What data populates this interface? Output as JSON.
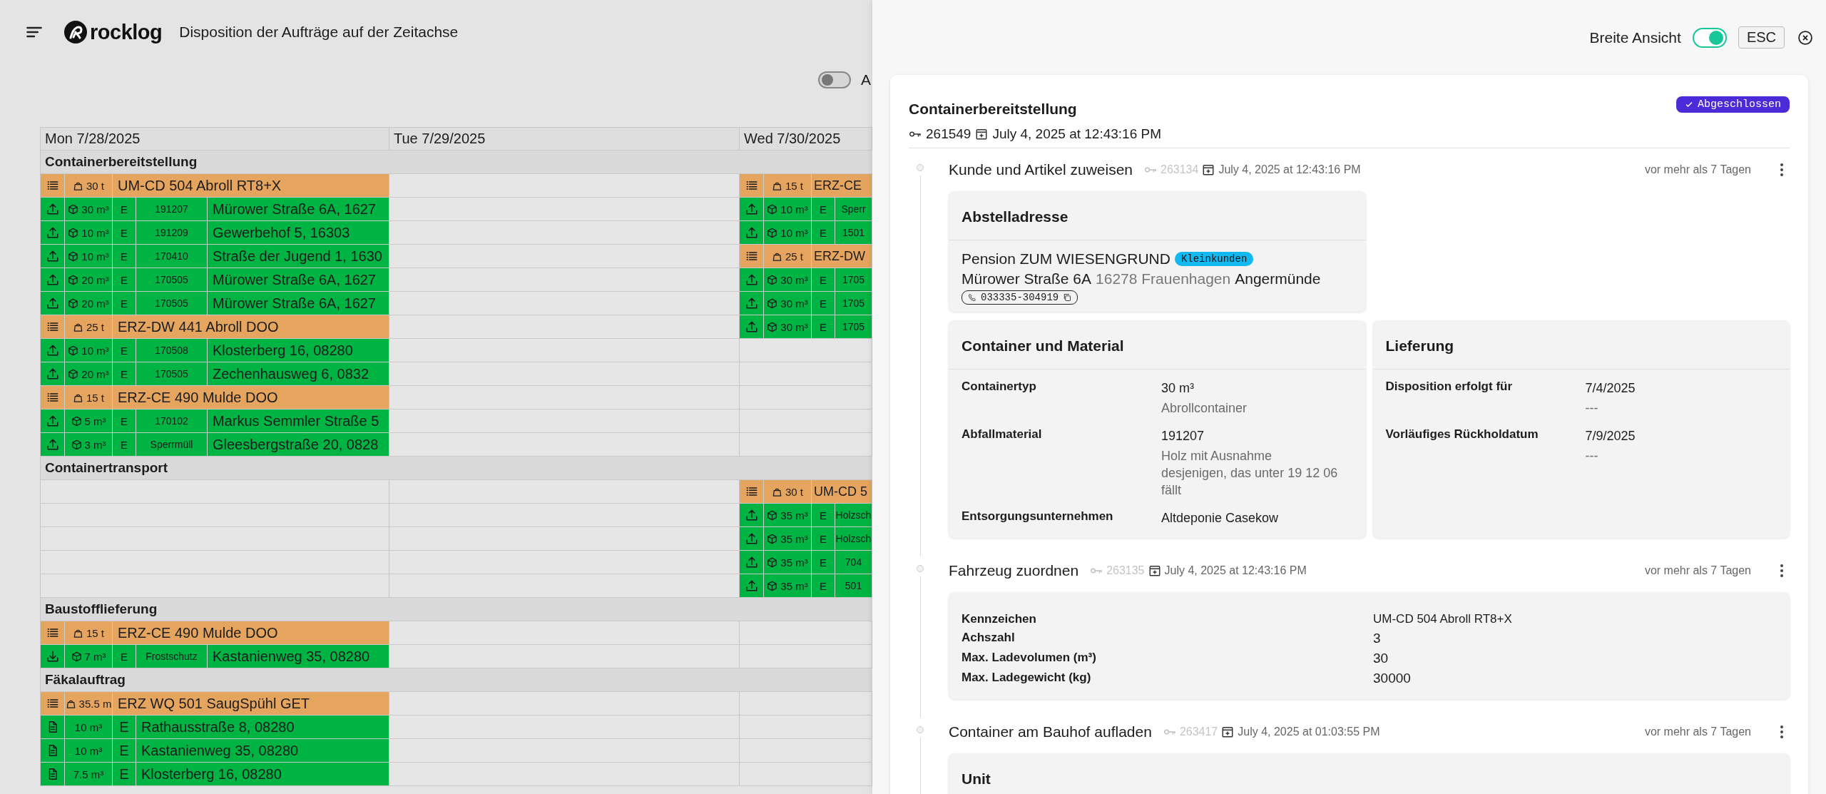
{
  "header": {
    "logo_text": "rocklog",
    "title": "Disposition der Aufträge auf der Zeitachse"
  },
  "view_toggle": {
    "label": "A",
    "on": false
  },
  "timeline": {
    "days": [
      "Mon 7/28/2025",
      "Tue 7/29/2025",
      "Wed 7/30/2025"
    ],
    "sections": [
      {
        "title": "Containerbereitstellung",
        "rows": [
          {
            "cells": [
              {
                "kind": "vehicle",
                "capacity": "30 t",
                "name": "UM-CD 504 Abroll RT8+X"
              },
              {
                "kind": "empty"
              },
              {
                "kind": "vehicle",
                "capacity": "15 t",
                "name": "ERZ-CE"
              }
            ]
          },
          {
            "cells": [
              {
                "kind": "order",
                "delivery": false,
                "volume": "30 m³",
                "type": "E",
                "code": "191207",
                "address": "Mürower Straße 6A, 1627"
              },
              {
                "kind": "empty"
              },
              {
                "kind": "order",
                "delivery": false,
                "volume": "10 m³",
                "type": "E",
                "code": "Sperr"
              }
            ]
          },
          {
            "cells": [
              {
                "kind": "order",
                "delivery": false,
                "volume": "10 m³",
                "type": "E",
                "code": "191209",
                "address": "Gewerbehof 5, 16303"
              },
              {
                "kind": "empty"
              },
              {
                "kind": "order",
                "delivery": false,
                "volume": "10 m³",
                "type": "E",
                "code": "1501"
              }
            ]
          },
          {
            "cells": [
              {
                "kind": "order",
                "delivery": false,
                "volume": "10 m³",
                "type": "E",
                "code": "170410",
                "address": "Straße der Jugend 1, 1630"
              },
              {
                "kind": "empty"
              },
              {
                "kind": "vehicle",
                "capacity": "25 t",
                "name": "ERZ-DW"
              }
            ]
          },
          {
            "cells": [
              {
                "kind": "order",
                "delivery": false,
                "volume": "20 m³",
                "type": "E",
                "code": "170505",
                "address": "Mürower Straße 6A, 1627"
              },
              {
                "kind": "empty"
              },
              {
                "kind": "order",
                "delivery": false,
                "volume": "30 m³",
                "type": "E",
                "code": "1705"
              }
            ]
          },
          {
            "cells": [
              {
                "kind": "order",
                "delivery": false,
                "volume": "20 m³",
                "type": "E",
                "code": "170505",
                "address": "Mürower Straße 6A, 1627"
              },
              {
                "kind": "empty"
              },
              {
                "kind": "order",
                "delivery": false,
                "volume": "30 m³",
                "type": "E",
                "code": "1705"
              }
            ]
          },
          {
            "cells": [
              {
                "kind": "vehicle",
                "capacity": "25 t",
                "name": "ERZ-DW 441 Abroll DOO"
              },
              {
                "kind": "empty"
              },
              {
                "kind": "order",
                "delivery": false,
                "volume": "30 m³",
                "type": "E",
                "code": "1705"
              }
            ]
          },
          {
            "cells": [
              {
                "kind": "order",
                "delivery": false,
                "volume": "10 m³",
                "type": "E",
                "code": "170508",
                "address": "Klosterberg 16, 08280"
              },
              {
                "kind": "empty"
              },
              {
                "kind": "empty"
              }
            ]
          },
          {
            "cells": [
              {
                "kind": "order",
                "delivery": false,
                "volume": "20 m³",
                "type": "E",
                "code": "170505",
                "address": "Zechenhausweg 6, 0832"
              },
              {
                "kind": "empty"
              },
              {
                "kind": "empty"
              }
            ]
          },
          {
            "cells": [
              {
                "kind": "vehicle",
                "capacity": "15 t",
                "name": "ERZ-CE 490 Mulde DOO"
              },
              {
                "kind": "empty"
              },
              {
                "kind": "empty"
              }
            ]
          },
          {
            "cells": [
              {
                "kind": "order",
                "delivery": false,
                "volume": "5 m³",
                "type": "E",
                "code": "170102",
                "address": "Markus Semmler Straße 5"
              },
              {
                "kind": "empty"
              },
              {
                "kind": "empty"
              }
            ]
          },
          {
            "cells": [
              {
                "kind": "order",
                "delivery": false,
                "volume": "3 m³",
                "type": "E",
                "code": "Sperrmüll",
                "address": "Gleesbergstraße 20, 0828"
              },
              {
                "kind": "empty"
              },
              {
                "kind": "empty"
              }
            ]
          }
        ]
      },
      {
        "title": "Containertransport",
        "rows": [
          {
            "cells": [
              {
                "kind": "empty"
              },
              {
                "kind": "empty"
              },
              {
                "kind": "vehicle",
                "capacity": "30 t",
                "name": "UM-CD 5"
              }
            ]
          },
          {
            "cells": [
              {
                "kind": "empty"
              },
              {
                "kind": "empty"
              },
              {
                "kind": "order",
                "delivery": false,
                "volume": "35 m³",
                "type": "E",
                "code": "Holzsch"
              }
            ]
          },
          {
            "cells": [
              {
                "kind": "empty"
              },
              {
                "kind": "empty"
              },
              {
                "kind": "order",
                "delivery": false,
                "volume": "35 m³",
                "type": "E",
                "code": "Holzsch"
              }
            ]
          },
          {
            "cells": [
              {
                "kind": "empty"
              },
              {
                "kind": "empty"
              },
              {
                "kind": "order",
                "delivery": false,
                "volume": "35 m³",
                "type": "E",
                "code": "704"
              }
            ]
          },
          {
            "cells": [
              {
                "kind": "empty"
              },
              {
                "kind": "empty"
              },
              {
                "kind": "order",
                "delivery": false,
                "volume": "35 m³",
                "type": "E",
                "code": "501"
              }
            ]
          }
        ]
      },
      {
        "title": "Baustofflieferung",
        "rows": [
          {
            "cells": [
              {
                "kind": "vehicle",
                "capacity": "15 t",
                "name": "ERZ-CE 490 Mulde DOO"
              },
              {
                "kind": "empty"
              },
              {
                "kind": "empty"
              }
            ]
          },
          {
            "cells": [
              {
                "kind": "order",
                "delivery": true,
                "volume": "7 m³",
                "type": "E",
                "code": "Frostschutz",
                "address": "Kastanienweg 35, 08280"
              },
              {
                "kind": "empty"
              },
              {
                "kind": "empty"
              }
            ]
          }
        ]
      },
      {
        "title": "Fäkalauftrag",
        "rows": [
          {
            "cells": [
              {
                "kind": "vehicle",
                "capacity": "35.5 m",
                "name": "ERZ WQ 501 SaugSpühl GET"
              },
              {
                "kind": "empty"
              },
              {
                "kind": "empty"
              }
            ]
          },
          {
            "cells": [
              {
                "kind": "fecal",
                "volume": "10 m³",
                "type": "E",
                "address": "Rathausstraße 8, 08280"
              },
              {
                "kind": "empty"
              },
              {
                "kind": "empty"
              }
            ]
          },
          {
            "cells": [
              {
                "kind": "fecal",
                "volume": "10 m³",
                "type": "E",
                "address": "Kastanienweg 35, 08280"
              },
              {
                "kind": "empty"
              },
              {
                "kind": "empty"
              }
            ]
          },
          {
            "cells": [
              {
                "kind": "fecal",
                "volume": "7.5 m³",
                "type": "E",
                "address": "Klosterberg 16, 08280"
              },
              {
                "kind": "empty"
              },
              {
                "kind": "empty"
              }
            ]
          }
        ]
      }
    ]
  },
  "panel": {
    "wide_view": {
      "label": "Breite Ansicht",
      "on": true
    },
    "esc_label": "ESC",
    "order": {
      "title": "Containerbereitstellung",
      "status": "Abgeschlossen",
      "id": "261549",
      "date": "July 4, 2025 at 12:43:16 PM",
      "steps": [
        {
          "title": "Kunde und Artikel zuweisen",
          "id": "263134",
          "date": "July 4, 2025 at 12:43:16 PM",
          "ago": "vor mehr als 7 Tagen",
          "cards": [
            {
              "kind": "address",
              "title": "Abstelladresse",
              "name": "Pension ZUM WIESENGRUND",
              "tag": "Kleinkunden",
              "street": "Mürower Straße 6A",
              "postal_city": "16278 Frauenhagen",
              "district": "Angermünde",
              "phone": "033335-304919"
            },
            {
              "kind": "fields",
              "title": "Container und Material",
              "fields": [
                {
                  "label": "Containertyp",
                  "value": "30 m³",
                  "note": "Abrollcontainer"
                },
                {
                  "label": "Abfallmaterial",
                  "value": "191207",
                  "note": "Holz mit Ausnahme desjenigen, das unter 19 12 06 fällt"
                },
                {
                  "label": "Entsorgungsunternehmen",
                  "value": "Altdeponie Casekow"
                }
              ]
            },
            {
              "kind": "fields",
              "title": "Lieferung",
              "fields": [
                {
                  "label": "Disposition erfolgt für",
                  "value": "7/4/2025",
                  "note": "---"
                },
                {
                  "label": "Vorläufiges Rückholdatum",
                  "value": "7/9/2025",
                  "note": "---"
                }
              ]
            }
          ]
        },
        {
          "title": "Fahrzeug zuordnen",
          "id": "263135",
          "date": "July 4, 2025 at 12:43:16 PM",
          "ago": "vor mehr als 7 Tagen",
          "cards": [
            {
              "kind": "table",
              "fields": [
                {
                  "label": "Kennzeichen",
                  "value": "UM-CD 504 Abroll RT8+X"
                },
                {
                  "label": "Achszahl",
                  "value": "3"
                },
                {
                  "label": "Max. Ladevolumen (m³)",
                  "value": "30"
                },
                {
                  "label": "Max. Ladegewicht (kg)",
                  "value": "30000"
                }
              ]
            }
          ]
        },
        {
          "title": "Container am Bauhof aufladen",
          "id": "263417",
          "date": "July 4, 2025 at 01:03:55 PM",
          "ago": "vor mehr als 7 Tagen",
          "cards": [
            {
              "kind": "table",
              "title": "Unit"
            }
          ]
        }
      ]
    }
  }
}
